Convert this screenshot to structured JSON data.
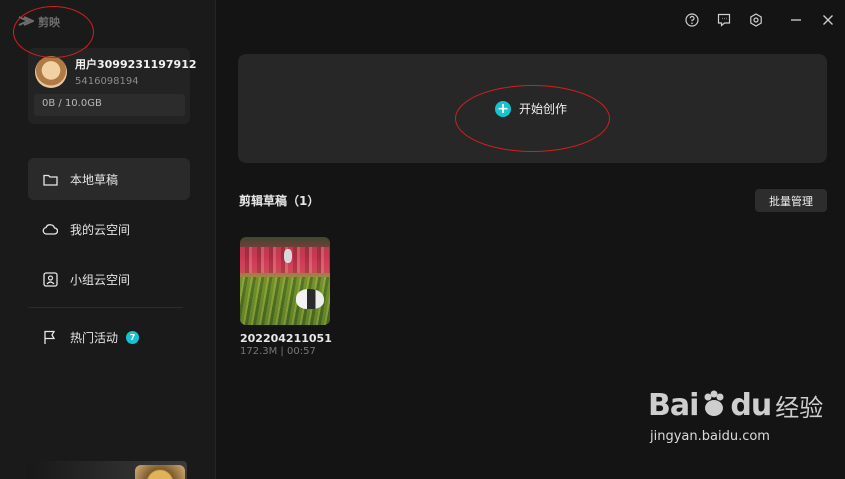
{
  "app": {
    "name": "剪映"
  },
  "user": {
    "name": "用户3099231197912",
    "id": "5416098194",
    "storage": "0B / 10.0GB"
  },
  "sidebar": {
    "items": [
      {
        "label": "本地草稿",
        "icon": "folder-icon"
      },
      {
        "label": "我的云空间",
        "icon": "cloud-icon"
      },
      {
        "label": "小组云空间",
        "icon": "team-cloud-icon"
      },
      {
        "label": "热门活动",
        "icon": "flag-icon",
        "badge": "7"
      }
    ]
  },
  "topbar": {
    "icons": [
      "help-icon",
      "feedback-icon",
      "settings-icon",
      "minimize-icon",
      "close-icon"
    ]
  },
  "main": {
    "create_label": "开始创作",
    "drafts_title": "剪辑草稿（1）",
    "batch_label": "批量管理",
    "drafts": [
      {
        "name": "202204211051",
        "meta": "172.3M | 00:57"
      }
    ]
  },
  "watermark": {
    "brand": "Bai",
    "brand2": "du",
    "cn": "经验",
    "url": "jingyan.baidu.com"
  },
  "colors": {
    "accent": "#16c3d1",
    "annotation": "#d21f1f"
  }
}
